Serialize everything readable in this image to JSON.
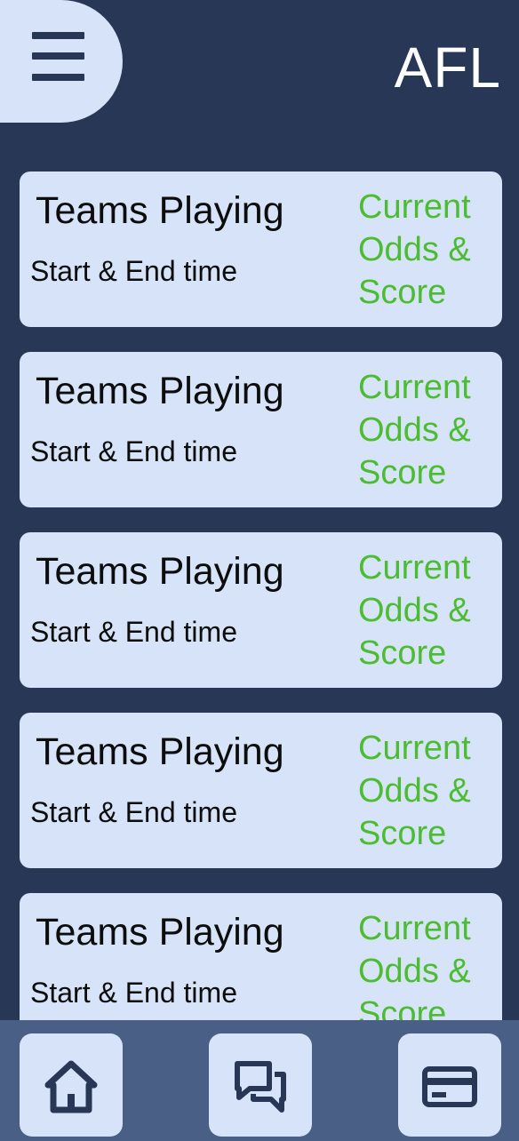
{
  "header": {
    "title": "AFL",
    "menu_icon": "hamburger-menu-icon"
  },
  "matches": [
    {
      "teams": "Teams Playing",
      "time": "Start & End time",
      "odds": "Current Odds & Score"
    },
    {
      "teams": "Teams Playing",
      "time": "Start & End time",
      "odds": "Current Odds & Score"
    },
    {
      "teams": "Teams Playing",
      "time": "Start & End time",
      "odds": "Current Odds & Score"
    },
    {
      "teams": "Teams Playing",
      "time": "Start & End time",
      "odds": "Current Odds & Score"
    },
    {
      "teams": "Teams Playing",
      "time": "Start & End time",
      "odds": "Current Odds & Score"
    }
  ],
  "nav": {
    "items": [
      {
        "icon": "home-icon"
      },
      {
        "icon": "chat-icon"
      },
      {
        "icon": "card-icon"
      }
    ]
  },
  "colors": {
    "background": "#283755",
    "card": "#d6e3f8",
    "nav_bar": "#4a5f86",
    "odds_text": "#4cbc32",
    "title_text": "#ffffff"
  }
}
